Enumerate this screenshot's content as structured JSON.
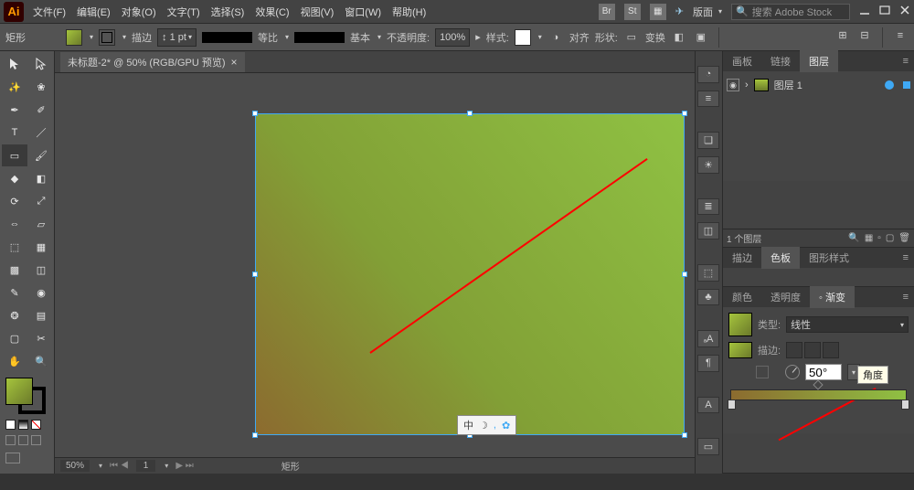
{
  "app": "Ai",
  "menu": [
    "文件(F)",
    "编辑(E)",
    "对象(O)",
    "文字(T)",
    "选择(S)",
    "效果(C)",
    "视图(V)",
    "窗口(W)",
    "帮助(H)"
  ],
  "title_right": {
    "badges": [
      "Br",
      "St"
    ],
    "layout": "版面",
    "search_placeholder": "搜索 Adobe Stock"
  },
  "options": {
    "left_label": "矩形",
    "stroke_label": "描边",
    "stroke_weight": "1 pt",
    "uniform": "等比",
    "basic": "基本",
    "opacity_label": "不透明度:",
    "opacity": "100%",
    "style": "样式:",
    "align": "对齐",
    "shape": "形状:",
    "transform": "变换"
  },
  "doc": {
    "tab_title": "未标题-2* @ 50% (RGB/GPU 预览)",
    "zoom": "50%",
    "page": "1",
    "selection": "矩形"
  },
  "panels": {
    "layer_tabs": [
      "画板",
      "链接",
      "图层"
    ],
    "layers": [
      {
        "name": "图层 1"
      }
    ],
    "layer_count": "1 个图层",
    "tabs2": [
      "描边",
      "色板",
      "图形样式"
    ],
    "tabs3": [
      "颜色",
      "透明度",
      "◦ 渐变"
    ],
    "gradient": {
      "type_label": "类型:",
      "type_value": "线性",
      "stroke_label": "描边:",
      "angle_value": "50°",
      "angle_tooltip_label": "角度"
    }
  },
  "float_icons": [
    "中",
    "☽",
    "⁜",
    "✿"
  ]
}
